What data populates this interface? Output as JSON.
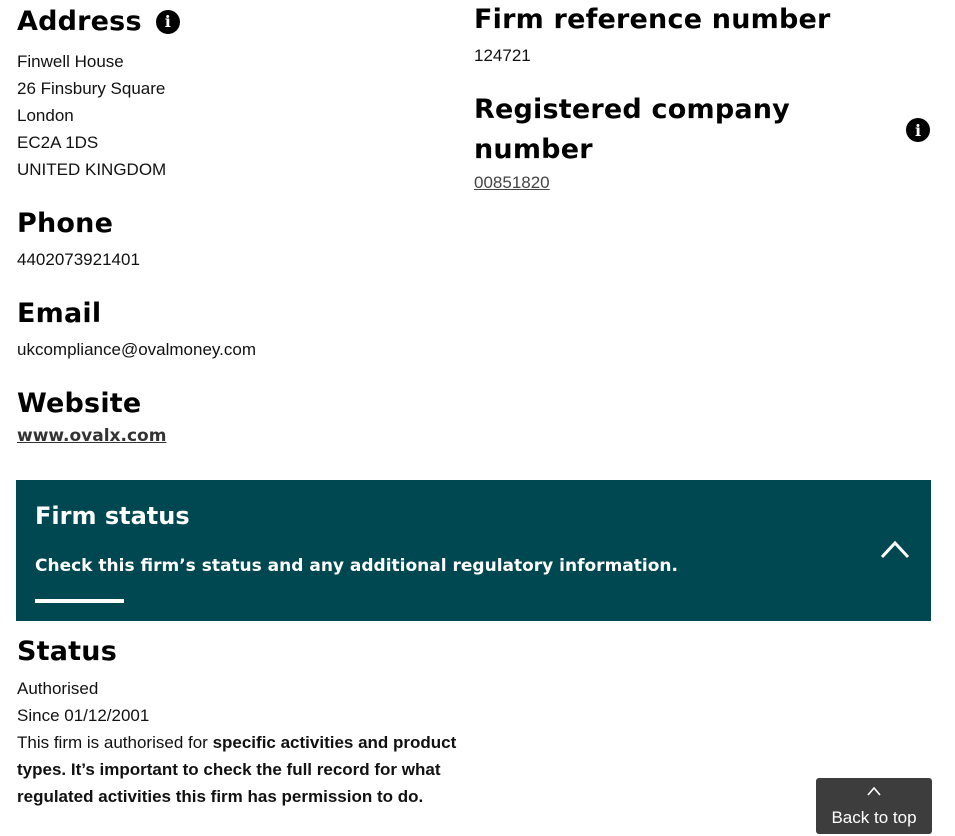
{
  "address": {
    "heading": "Address",
    "info_icon": "info-icon",
    "lines": [
      "Finwell House",
      "26 Finsbury Square",
      "London",
      "EC2A 1DS",
      "UNITED KINGDOM"
    ]
  },
  "phone": {
    "heading": "Phone",
    "value": "4402073921401"
  },
  "email": {
    "heading": "Email",
    "value": "ukcompliance@ovalmoney.com"
  },
  "website": {
    "heading": "Website",
    "value": "www.ovalx.com"
  },
  "firm_reference": {
    "heading": "Firm reference number",
    "value": "124721"
  },
  "registered_company": {
    "heading": "Registered company number",
    "info_icon": "info-icon",
    "value": "00851820"
  },
  "firm_status_banner": {
    "title": "Firm status",
    "subtitle": "Check this firm’s status and any additional regulatory information.",
    "toggle_icon": "chevron-up-icon",
    "background": "#004851"
  },
  "status": {
    "heading": "Status",
    "value": "Authorised",
    "since": "Since 01/12/2001",
    "note_prefix": "This firm is authorised for ",
    "note_bold": "specific activities and product types. It’s important to check the full record for what regulated activities this firm has permission to do."
  },
  "back_to_top": {
    "label": "Back to top",
    "icon": "chevron-up-icon"
  }
}
